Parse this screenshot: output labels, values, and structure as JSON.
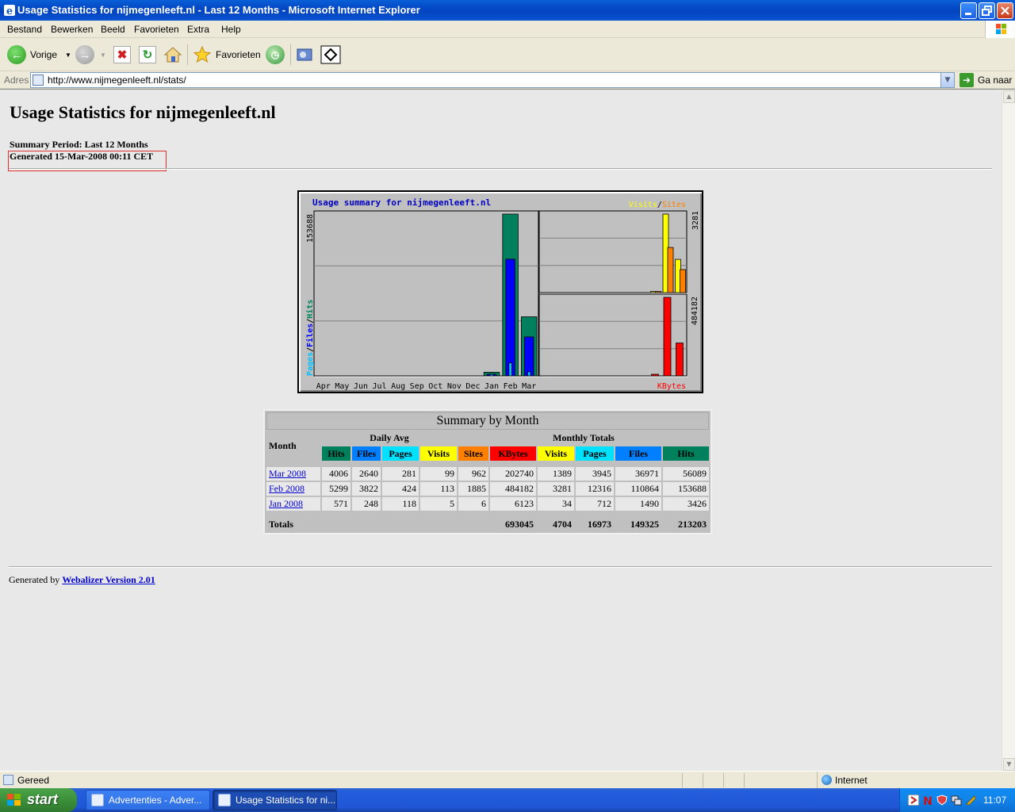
{
  "window": {
    "title": "Usage Statistics for nijmegenleeft.nl - Last 12 Months - Microsoft Internet Explorer",
    "controls": [
      "minimize-icon",
      "restore-icon",
      "close-icon"
    ]
  },
  "menu": [
    "Bestand",
    "Bewerken",
    "Beeld",
    "Favorieten",
    "Extra",
    "Help"
  ],
  "toolbar": {
    "back_label": "Vorige",
    "favorites_label": "Favorieten",
    "icons": [
      "back-arrow-icon",
      "forward-arrow-icon",
      "stop-icon",
      "refresh-icon",
      "home-icon",
      "favorites-star-icon",
      "history-icon",
      "media-icon",
      "tools-icon"
    ]
  },
  "address": {
    "label": "Adres",
    "url": "http://www.nijmegenleeft.nl/stats/",
    "go_label": "Ga naar"
  },
  "page": {
    "heading": "Usage Statistics for nijmegenleeft.nl",
    "summary_period": "Summary Period: Last 12 Months",
    "generated": "Generated 15-Mar-2008 00:11 CET",
    "footer_prefix": "Generated by ",
    "footer_link": "Webalizer Version 2.01"
  },
  "chart_data": {
    "type": "bar",
    "title": "Usage summary for nijmegenleeft.nl",
    "categories": [
      "Apr",
      "May",
      "Jun",
      "Jul",
      "Aug",
      "Sep",
      "Oct",
      "Nov",
      "Dec",
      "Jan",
      "Feb",
      "Mar"
    ],
    "left_panel": {
      "max_label": "153688",
      "axis_labels": [
        "Pages",
        "/",
        "Files",
        "/",
        "Hits"
      ],
      "series": [
        {
          "name": "Hits",
          "color": "#00805c",
          "values": [
            0,
            0,
            0,
            0,
            0,
            0,
            0,
            0,
            0,
            3426,
            153688,
            56089
          ]
        },
        {
          "name": "Files",
          "color": "#0000ff",
          "values": [
            0,
            0,
            0,
            0,
            0,
            0,
            0,
            0,
            0,
            1490,
            110864,
            36971
          ]
        },
        {
          "name": "Pages",
          "color": "#00c0ff",
          "values": [
            0,
            0,
            0,
            0,
            0,
            0,
            0,
            0,
            0,
            712,
            12316,
            3945
          ]
        }
      ]
    },
    "top_right_panel": {
      "max_label": "3281",
      "legend": [
        "Visits",
        "/",
        "Sites"
      ],
      "series": [
        {
          "name": "Visits",
          "color": "#ffff00",
          "values": [
            0,
            0,
            0,
            0,
            0,
            0,
            0,
            0,
            0,
            34,
            3281,
            1389
          ]
        },
        {
          "name": "Sites",
          "color": "#ff8000",
          "values": [
            0,
            0,
            0,
            0,
            0,
            0,
            0,
            0,
            0,
            6,
            1885,
            962
          ]
        }
      ]
    },
    "bottom_right_panel": {
      "max_label": "484182",
      "legend": "KBytes",
      "series": [
        {
          "name": "KBytes",
          "color": "#ff0000",
          "values": [
            0,
            0,
            0,
            0,
            0,
            0,
            0,
            0,
            0,
            6123,
            484182,
            202740
          ]
        }
      ]
    },
    "grid": true
  },
  "summary_table": {
    "caption": "Summary by Month",
    "month_header": "Month",
    "daily_avg_header": "Daily Avg",
    "monthly_totals_header": "Monthly Totals",
    "columns": [
      {
        "label": "Hits",
        "color": "#00805c"
      },
      {
        "label": "Files",
        "color": "#0080ff"
      },
      {
        "label": "Pages",
        "color": "#00e0ff"
      },
      {
        "label": "Visits",
        "color": "#ffff00"
      },
      {
        "label": "Sites",
        "color": "#ff8000"
      },
      {
        "label": "KBytes",
        "color": "#ff0000"
      },
      {
        "label": "Visits",
        "color": "#ffff00"
      },
      {
        "label": "Pages",
        "color": "#00e0ff"
      },
      {
        "label": "Files",
        "color": "#0080ff"
      },
      {
        "label": "Hits",
        "color": "#00805c"
      }
    ],
    "rows": [
      {
        "month": "Mar 2008",
        "values": [
          "4006",
          "2640",
          "281",
          "99",
          "962",
          "202740",
          "1389",
          "3945",
          "36971",
          "56089"
        ]
      },
      {
        "month": "Feb 2008",
        "values": [
          "5299",
          "3822",
          "424",
          "113",
          "1885",
          "484182",
          "3281",
          "12316",
          "110864",
          "153688"
        ]
      },
      {
        "month": "Jan 2008",
        "values": [
          "571",
          "248",
          "118",
          "5",
          "6",
          "6123",
          "34",
          "712",
          "1490",
          "3426"
        ]
      }
    ],
    "totals_label": "Totals",
    "totals": [
      "693045",
      "4704",
      "16973",
      "149325",
      "213203"
    ]
  },
  "statusbar": {
    "status": "Gereed",
    "zone": "Internet"
  },
  "taskbar": {
    "start_label": "start",
    "tasks": [
      {
        "label": "Advertenties - Adver...",
        "active": false
      },
      {
        "label": "Usage Statistics for ni...",
        "active": true
      }
    ],
    "clock": "11:07"
  }
}
